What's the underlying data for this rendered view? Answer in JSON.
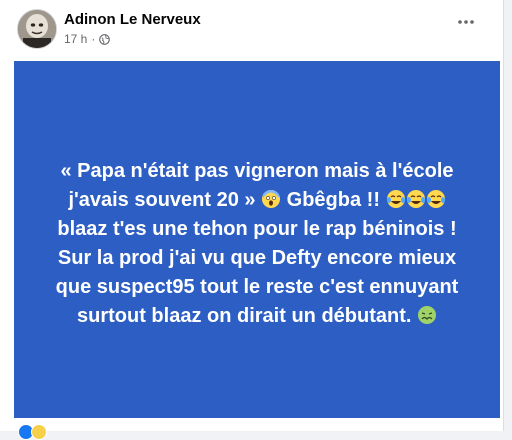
{
  "post": {
    "author": "Adinon Le Nerveux",
    "time": "17 h",
    "separator": "·",
    "privacy_icon": "globe-icon",
    "more_icon": "more-options-icon"
  },
  "card": {
    "background": "#2d5ec3",
    "text_color": "#ffffff",
    "line1": "« Papa n'était pas vigneron mais à l'école j'avais souvent 20 »",
    "line1_emoji": "face-screaming-in-fear",
    "line2_a": "Gbêgba !!",
    "line2_emoji": "face-with-tears-of-joy-x3",
    "line2_b": "blaaz t'es une tehon pour le rap béninois !",
    "line3": "Sur la prod j'ai vu que Defty encore mieux que suspect95 tout le reste c'est ennuyant surtout blaaz on dirait un débutant.",
    "line3_emoji": "nauseated-face"
  },
  "reactions": {
    "icons": [
      "like-icon",
      "haha-icon"
    ]
  }
}
